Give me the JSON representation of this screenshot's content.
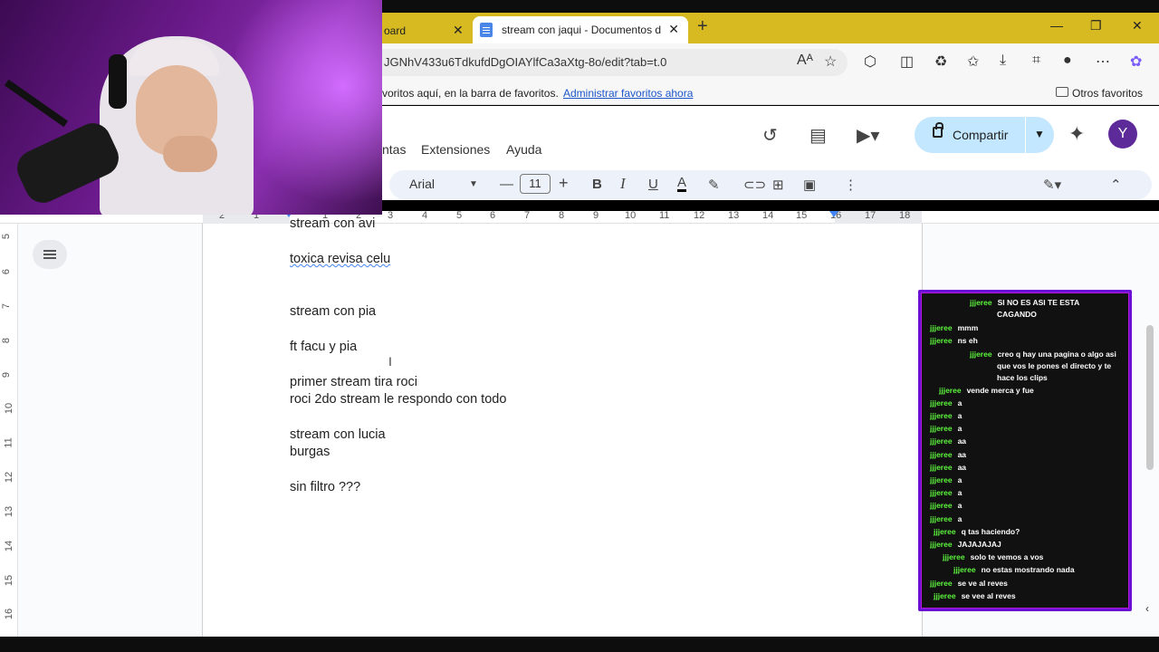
{
  "browser": {
    "prev_tab_label": "oard",
    "active_tab_title": "stream con jaqui - Documentos d",
    "url": "JGNhV433u6TdkufdDgOIAYlfCa3aXtg-8o/edit?tab=t.0",
    "favbar_message": "voritos aquí, en la barra de favoritos.",
    "favbar_manage": "Administrar favoritos ahora",
    "favbar_others": "Otros favoritos"
  },
  "docs": {
    "menus": [
      "ntas",
      "Extensiones",
      "Ayuda"
    ],
    "share_label": "Compartir",
    "avatar_initial": "Y",
    "font_name": "Arial",
    "font_size": "11",
    "ruler_numbers": [
      "2",
      "1",
      "1",
      "2",
      "3",
      "4",
      "5",
      "6",
      "7",
      "8",
      "9",
      "10",
      "11",
      "12",
      "13",
      "14",
      "15",
      "16",
      "17",
      "18"
    ],
    "vruler_numbers": [
      "5",
      "6",
      "7",
      "8",
      "9",
      "10",
      "11",
      "12",
      "13",
      "14",
      "15",
      "16"
    ]
  },
  "document": {
    "lines": [
      "stream con avi",
      "toxica revisa celu",
      "stream con pia",
      "ft facu y pia",
      "primer stream tira roci",
      "roci 2do stream  le respondo con todo",
      "stream con lucia",
      "burgas",
      "sin filtro ???"
    ]
  },
  "chat": {
    "user_color": "#5cf53d",
    "border_color": "#6b0fd6",
    "messages": [
      {
        "user": "jjjeree",
        "text": "SI NO ES ASI TE ESTA"
      },
      {
        "user": "",
        "text": "CAGANDO"
      },
      {
        "user": "jjjeree",
        "text": "mmm"
      },
      {
        "user": "jjjeree",
        "text": "ns eh"
      },
      {
        "user": "jjjeree",
        "text": "creo q hay una pagina o algo asi"
      },
      {
        "user": "",
        "text": "que vos le pones el directo y te"
      },
      {
        "user": "",
        "text": "hace los clips"
      },
      {
        "user": "jjjeree",
        "text": "vende merca y fue"
      },
      {
        "user": "jjjeree",
        "text": "a"
      },
      {
        "user": "jjjeree",
        "text": "a"
      },
      {
        "user": "jjjeree",
        "text": "a"
      },
      {
        "user": "jjjeree",
        "text": "aa"
      },
      {
        "user": "jjjeree",
        "text": "aa"
      },
      {
        "user": "jjjeree",
        "text": "aa"
      },
      {
        "user": "jjjeree",
        "text": "a"
      },
      {
        "user": "jjjeree",
        "text": "a"
      },
      {
        "user": "jjjeree",
        "text": "a"
      },
      {
        "user": "jjjeree",
        "text": "a"
      },
      {
        "user": "jjjeree",
        "text": "q tas haciendo?"
      },
      {
        "user": "jjjeree",
        "text": "JAJAJAJAJ"
      },
      {
        "user": "jjjeree",
        "text": "solo te vemos a vos"
      },
      {
        "user": "jjjeree",
        "text": "no estas mostrando nada"
      },
      {
        "user": "jjjeree",
        "text": "se ve al reves"
      },
      {
        "user": "jjjeree",
        "text": "se vee al reves"
      }
    ]
  }
}
